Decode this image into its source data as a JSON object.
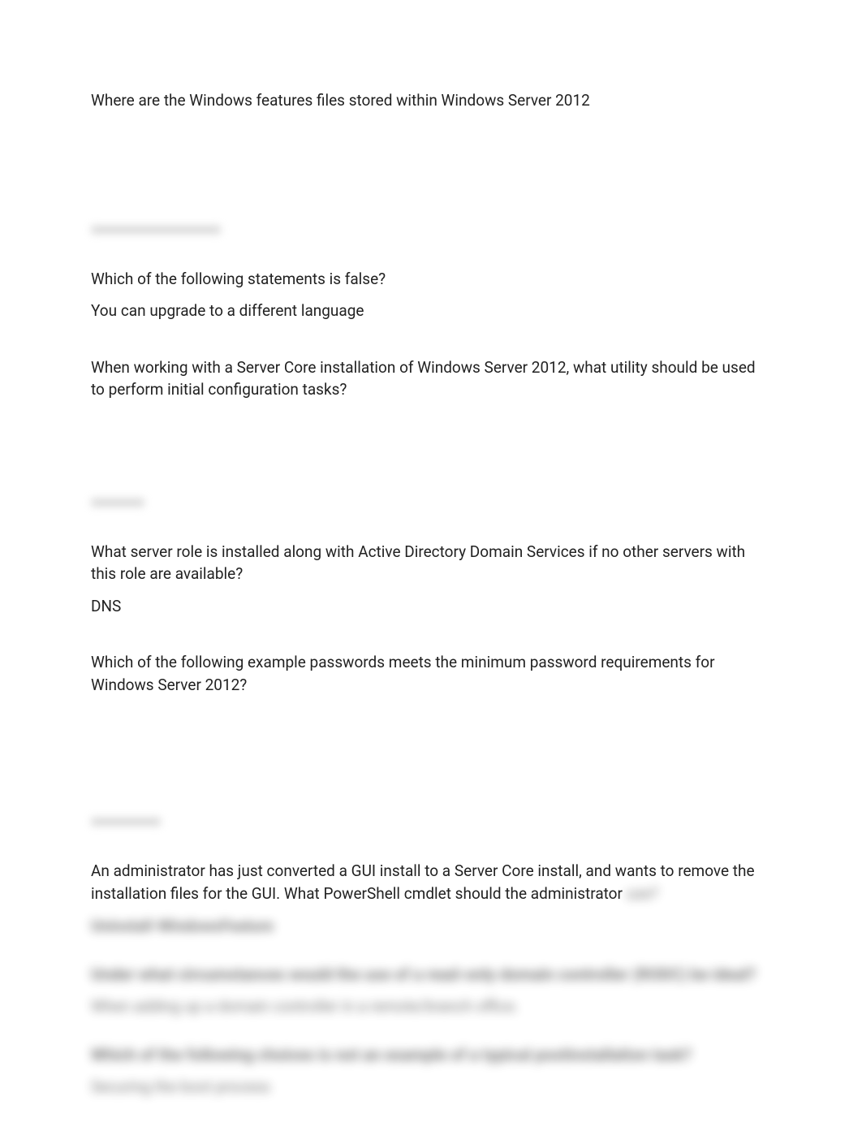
{
  "q1": {
    "question": "Where are the Windows features files stored within Windows Server 2012"
  },
  "q2": {
    "question": "Which of the following statements is false?",
    "answer": "You can upgrade to a different language"
  },
  "q3": {
    "question": "When working with a Server Core installation of Windows Server 2012, what utility should be used to perform initial configuration tasks?"
  },
  "q4": {
    "question": "What server role is installed along with Active Directory Domain Services if no other servers with this role are available?",
    "answer": "DNS"
  },
  "q5": {
    "question": "Which of the following example passwords meets the minimum password requirements for Windows Server 2012?"
  },
  "q6": {
    "question_visible": "An administrator has just converted a GUI install to a Server Core install, and wants to remove the installation files for the GUI. What PowerShell cmdlet should the administrator",
    "question_hidden": "use?",
    "answer_hidden": "Uninstall-WindowsFeature"
  },
  "hidden": {
    "q7": "Under what circumstances would the use of a read-only domain controller (RODC) be ideal?",
    "a7": "When adding up a domain controller in a remote/branch office.",
    "q8": "Which of the following choices is not an example of a typical postinstallation task?",
    "a8": "Securing the boot process"
  }
}
